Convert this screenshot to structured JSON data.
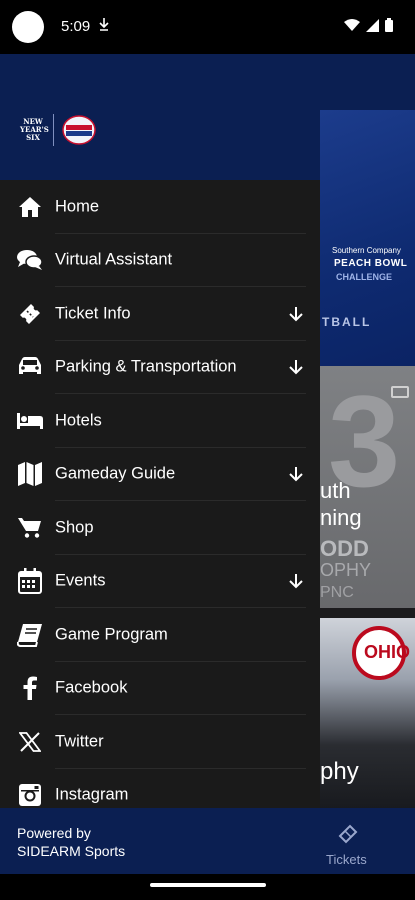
{
  "status_bar": {
    "time": "5:09"
  },
  "drawer": {
    "logo_text": "NEW YEAR'S SIX",
    "items": [
      {
        "label": "Home",
        "icon": "home-icon",
        "expandable": false
      },
      {
        "label": "Virtual Assistant",
        "icon": "chat-icon",
        "expandable": false
      },
      {
        "label": "Ticket Info",
        "icon": "ticket-icon",
        "expandable": true
      },
      {
        "label": "Parking & Transportation",
        "icon": "car-icon",
        "expandable": true
      },
      {
        "label": "Hotels",
        "icon": "bed-icon",
        "expandable": false
      },
      {
        "label": "Gameday Guide",
        "icon": "map-icon",
        "expandable": true
      },
      {
        "label": "Shop",
        "icon": "cart-icon",
        "expandable": false
      },
      {
        "label": "Events",
        "icon": "calendar-icon",
        "expandable": true
      },
      {
        "label": "Game Program",
        "icon": "book-icon",
        "expandable": false
      },
      {
        "label": "Facebook",
        "icon": "facebook-icon",
        "expandable": false
      },
      {
        "label": "Twitter",
        "icon": "x-twitter-icon",
        "expandable": false
      },
      {
        "label": "Instagram",
        "icon": "instagram-icon",
        "expandable": false
      }
    ],
    "footer": {
      "line1": "Powered by",
      "line2": "SIDEARM Sports"
    }
  },
  "background": {
    "hero_brand_line1": "Southern Company",
    "hero_brand_line2": "PEACH BOWL",
    "hero_brand_line3": "CHALLENGE",
    "hero_text": "TBALL",
    "card2_big": "3",
    "card2_line1": "uth",
    "card2_line2": "ning",
    "card2_line3": "ODD",
    "card2_line4": "OPHY",
    "card2_line5": "PNC",
    "card3_text": "phy",
    "card3_logo": "OHIO",
    "tab_label": "Tickets"
  },
  "colors": {
    "header_navy": "#0b1f52",
    "drawer_bg": "#1a1a1a"
  }
}
